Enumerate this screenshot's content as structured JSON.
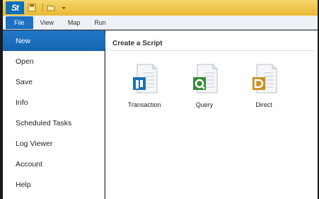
{
  "titlebar": {
    "logo_text": "St",
    "icons": [
      "save-icon",
      "open-icon",
      "dropdown-arrow-icon"
    ],
    "accent": "#e9b935"
  },
  "tabs": [
    {
      "label": "File"
    },
    {
      "label": "View"
    },
    {
      "label": "Map"
    },
    {
      "label": "Run"
    }
  ],
  "sidebar": {
    "active_color": "#1f78c8",
    "items": [
      {
        "label": "New"
      },
      {
        "label": "Open"
      },
      {
        "label": "Save"
      },
      {
        "label": "Info"
      },
      {
        "label": "Scheduled Tasks"
      },
      {
        "label": "Log Viewer"
      },
      {
        "label": "Account"
      },
      {
        "label": "Help"
      }
    ]
  },
  "content": {
    "title": "Create a Script",
    "tiles": [
      {
        "label": "Transaction",
        "icon": "transaction-script-icon",
        "color": "#1e6fb5"
      },
      {
        "label": "Query",
        "icon": "query-script-icon",
        "color": "#3b8a3a"
      },
      {
        "label": "Direct",
        "icon": "direct-script-icon",
        "color": "#c8901e"
      }
    ]
  }
}
